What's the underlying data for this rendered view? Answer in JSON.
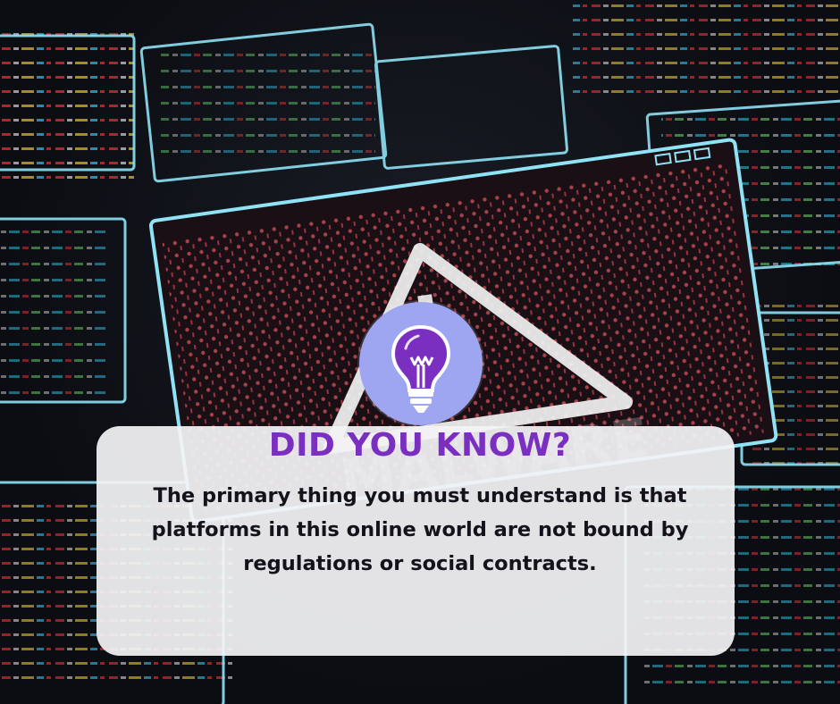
{
  "background": {
    "scene": "malware-warning-screens",
    "watermark_text": "MALWARE",
    "colors": {
      "window_outline": "#8fe3f5",
      "code_red": "#e23a3a",
      "binary_red": "#c7444c",
      "dark": "#0b0d12"
    }
  },
  "badge": {
    "icon": "lightbulb-icon",
    "circle_color": "#9ea6f2",
    "bulb_color": "#7a2fc0"
  },
  "card": {
    "title": "DID YOU KNOW?",
    "body": "The primary thing you must understand is that platforms in this online world are not bound by regulations or social contracts.",
    "title_color": "#7a2fc0"
  }
}
